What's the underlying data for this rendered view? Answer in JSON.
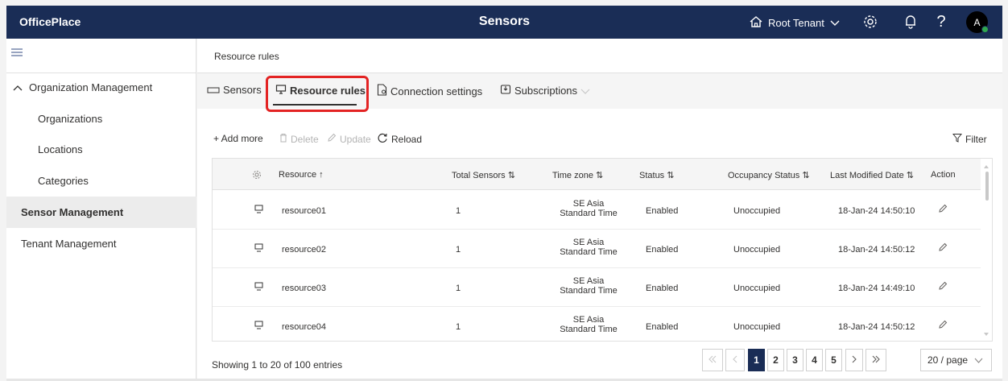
{
  "app": {
    "brand": "OfficePlace",
    "title": "Sensors",
    "tenant": "Root Tenant",
    "avatar_initial": "A"
  },
  "sidebar": {
    "group": "Organization Management",
    "items": [
      {
        "label": "Organizations"
      },
      {
        "label": "Locations"
      },
      {
        "label": "Categories"
      },
      {
        "label": "Sensor Management"
      },
      {
        "label": "Tenant Management"
      }
    ]
  },
  "breadcrumb": "Resource rules",
  "tabs": [
    {
      "label": "Sensors"
    },
    {
      "label": "Resource rules"
    },
    {
      "label": "Connection settings"
    },
    {
      "label": "Subscriptions"
    }
  ],
  "toolbar": {
    "add": "+ Add more",
    "delete": "Delete",
    "update": "Update",
    "reload": "Reload",
    "filter": "Filter"
  },
  "table": {
    "headers": [
      "Resource ↑",
      "Total Sensors ⇅",
      "Time zone ⇅",
      "Status ⇅",
      "Occupancy Status ⇅",
      "Last Modified Date ⇅",
      "Action"
    ],
    "rows": [
      {
        "resource": "resource01",
        "total": "1",
        "tz1": "SE Asia",
        "tz2": "Standard Time",
        "status": "Enabled",
        "occupancy": "Unoccupied",
        "modified": "18-Jan-24 14:50:10"
      },
      {
        "resource": "resource02",
        "total": "1",
        "tz1": "SE Asia",
        "tz2": "Standard Time",
        "status": "Enabled",
        "occupancy": "Unoccupied",
        "modified": "18-Jan-24 14:50:12"
      },
      {
        "resource": "resource03",
        "total": "1",
        "tz1": "SE Asia",
        "tz2": "Standard Time",
        "status": "Enabled",
        "occupancy": "Unoccupied",
        "modified": "18-Jan-24 14:49:10"
      },
      {
        "resource": "resource04",
        "total": "1",
        "tz1": "SE Asia",
        "tz2": "Standard Time",
        "status": "Enabled",
        "occupancy": "Unoccupied",
        "modified": "18-Jan-24 14:50:12"
      }
    ]
  },
  "footer": {
    "entries": "Showing 1 to 20 of 100 entries",
    "pages": [
      "1",
      "2",
      "3",
      "4",
      "5"
    ],
    "page_size": "20 / page"
  },
  "colors": {
    "header_bg": "#1a2d56",
    "highlight": "#e32323",
    "active_page": "#1a2d56"
  }
}
